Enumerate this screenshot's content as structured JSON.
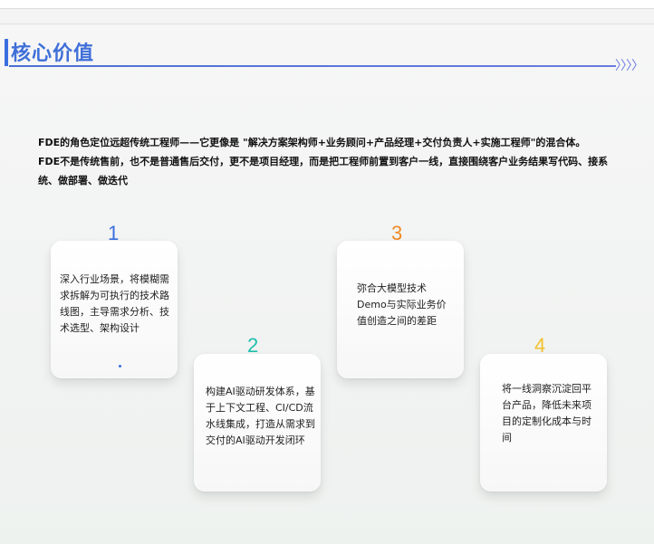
{
  "section": {
    "title": "核心价值",
    "chevrons": "〉〉〉〉"
  },
  "intro": {
    "line1": "FDE的角色定位远超传统工程师——它更像是 \"解决方案架构师+业务顾问+产品经理+交付负责人+实施工程师\"的混合体。",
    "line2": "FDE不是传统售前，也不是普通售后交付，更不是项目经理，而是把工程师前置到客户一线，直接围绕客户业务结果写代码、接系统、做部署、做迭代"
  },
  "cards": [
    {
      "number": "1",
      "color": "#3b6fe0",
      "text": "深入行业场景，将模糊需求拆解为可执行的技术路线图，主导需求分析、技术选型、架构设计"
    },
    {
      "number": "2",
      "color": "#1fbfae",
      "text": "构建AI驱动研发体系，基于上下文工程、CI/CD流水线集成，打造从需求到交付的AI驱动开发闭环"
    },
    {
      "number": "3",
      "color": "#f08a24",
      "text": "弥合大模型技术Demo与实际业务价值创造之间的差距"
    },
    {
      "number": "4",
      "color": "#f2c12e",
      "text": "将一线洞察沉淀回平台产品，降低未来项目的定制化成本与时间"
    }
  ]
}
